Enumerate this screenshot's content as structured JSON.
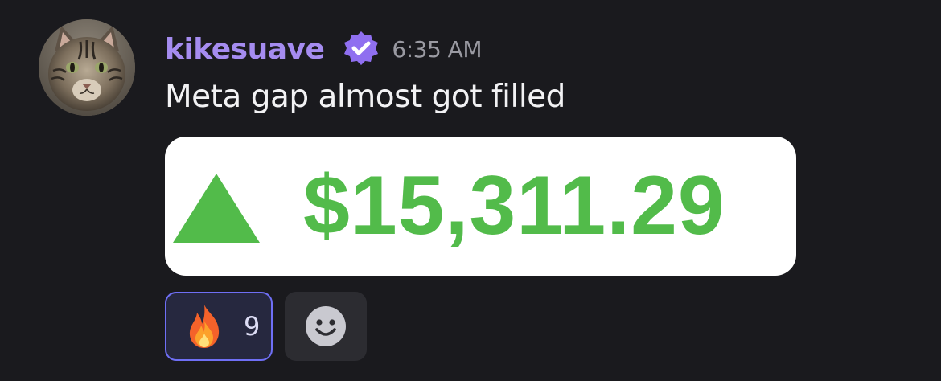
{
  "message": {
    "author": {
      "username": "kikesuave",
      "verified_icon": "verified-badge-icon",
      "avatar": "cat-avatar"
    },
    "timestamp": "6:35 AM",
    "text": "Meta gap almost got filled",
    "embed": {
      "arrow_icon": "up-triangle-icon",
      "amount": "$15,311.29",
      "amount_color": "#52bb4a"
    },
    "reactions": [
      {
        "emoji": "fire-emoji",
        "count": "9",
        "active": true
      }
    ],
    "add_reaction_icon": "smile-add-reaction-icon"
  },
  "colors": {
    "background": "#1a1a1e",
    "username": "#a58cf0",
    "reaction_border": "#6f6ff5"
  }
}
